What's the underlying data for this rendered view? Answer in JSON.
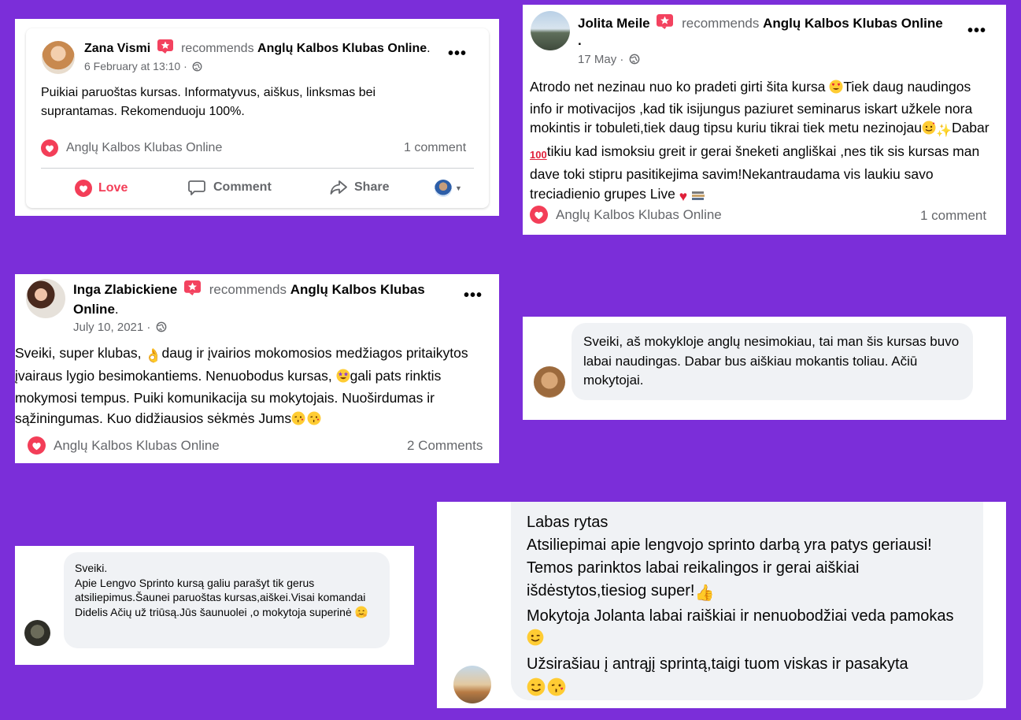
{
  "colors": {
    "background": "#7b2ed9",
    "love": "#f33e58",
    "link_text": "#65676b",
    "bubble": "#f0f2f5"
  },
  "common": {
    "recommends": "recommends",
    "page_name": "Anglų Kalbos Klubas Online",
    "period": "."
  },
  "card1": {
    "author": "Zana Vismi",
    "date": "6 February at 13:10 ·",
    "body": "Puikiai paruoštas kursas. Informatyvus, aiškus, linksmas bei suprantamas. Rekomenduoju 100%.",
    "footer_page": "Anglų Kalbos Klubas Online",
    "comments": "1 comment",
    "actions": {
      "love": "Love",
      "comment": "Comment",
      "share": "Share"
    }
  },
  "card2": {
    "author": "Jolita Meile",
    "date": "17 May ·",
    "body_part1": "Atrodo net nezinau nuo ko pradeti girti šita kursa",
    "body_part2": "Tiek daug naudingos info ir motivacijos ,kad tik isijungus paziuret seminarus iskart užkele nora mokintis ir tobuleti,tiek daug tipsu kuriu tikrai tiek metu nezinojau",
    "body_part3": "Dabar",
    "body_part4": "tikiu kad ismoksiu greit ir gerai šneketi angliškai ,nes tik sis kursas man dave toki stipru pasitikejima savim!Nekantraudama vis laukiu savo treciadienio grupes Live",
    "footer_page": "Anglų Kalbos Klubas Online",
    "comments": "1 comment"
  },
  "card3": {
    "author": "Inga Zlabickiene",
    "page_line1": "Anglų Kalbos Klubas",
    "page_line2": "Online",
    "date": "July 10, 2021 ·",
    "body_part1": "Sveiki, super klubas,",
    "body_part2": "daug ir įvairios mokomosios medžiagos pritaikytos įvairaus lygio besimokantiems. Nenuobodus kursas,",
    "body_part3": "gali pats rinktis mokymosi tempus. Puiki komunikacija su mokytojais. Nuoširdumas ir sąžiningumas. Kuo didžiausios sėkmės Jums",
    "footer_page": "Anglų Kalbos Klubas Online",
    "comments": "2 Comments"
  },
  "card4": {
    "text": "Sveiki, aš mokykloje anglų nesimokiau, tai man šis kursas buvo labai naudingas. Dabar bus aiškiau mokantis toliau. Ačiū mokytojai."
  },
  "card5": {
    "line1": "Sveiki.",
    "line2": "Apie Lengvo Sprinto kursą galiu parašyt tik gerus atsiliepimus.Šaunei paruoštas kursas,aiškei.Visai komandai Didelis Ačių už triūsą.Jūs šaunuolei ,o mokytoja superinė"
  },
  "card6": {
    "line1": "Labas rytas",
    "line2": "Atsiliepimai apie lengvojo sprinto darbą yra patys geriausi! Temos parinktos labai reikalingos ir gerai aiškiai išdėstytos,tiesiog super!",
    "line3": "Mokytoja Jolanta labai raiškiai ir nenuobodžiai veda pamokas",
    "line4": "Užsirašiau į antrąjį sprintą,taigi tuom viskas ir pasakyta"
  }
}
